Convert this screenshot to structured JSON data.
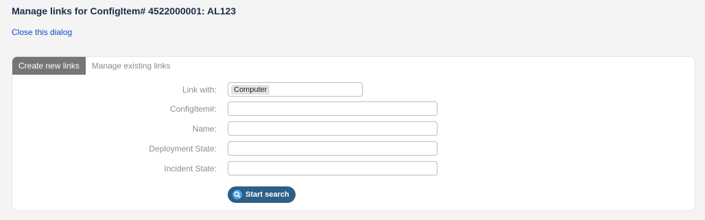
{
  "dialog": {
    "title": "Manage links for ConfigItem# 4522000001: AL123",
    "close_link": "Close this dialog"
  },
  "tabs": [
    {
      "label": "Create new links",
      "active": true
    },
    {
      "label": "Manage existing links",
      "active": false
    }
  ],
  "form": {
    "link_with": {
      "label": "Link with:",
      "selected": "Computer"
    },
    "configitem_number": {
      "label": "ConfigItem#:",
      "value": "",
      "placeholder": ""
    },
    "name": {
      "label": "Name:",
      "value": "",
      "placeholder": ""
    },
    "deployment_state": {
      "label": "Deployment State:",
      "value": "",
      "placeholder": ""
    },
    "incident_state": {
      "label": "Incident State:",
      "value": "",
      "placeholder": ""
    }
  },
  "search_button": {
    "label": "Start search",
    "icon": "search-icon"
  },
  "colors": {
    "accent_button": "#2e5f86",
    "active_tab": "#767676",
    "link": "#0b4ec7"
  }
}
